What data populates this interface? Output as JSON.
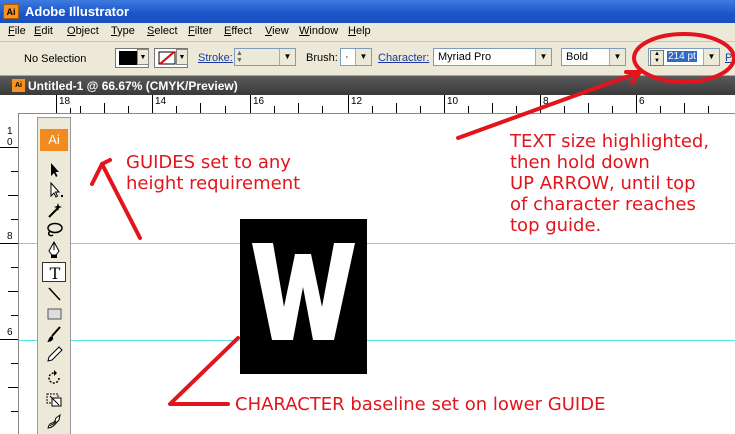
{
  "window": {
    "app_icon": "Ai",
    "title": "Adobe Illustrator"
  },
  "menu": [
    "File",
    "Edit",
    "Object",
    "Type",
    "Select",
    "Filter",
    "Effect",
    "View",
    "Window",
    "Help"
  ],
  "control_bar": {
    "selection": "No Selection",
    "stroke_label": "Stroke:",
    "brush_label": "Brush:",
    "brush_value": "·",
    "character_label": "Character:",
    "font_family": "Myriad Pro",
    "font_style": "Bold",
    "font_size": "214 pt",
    "overflow_label": "Pa",
    "fill_color": "#000000"
  },
  "document": {
    "icon": "Ai",
    "title": "Untitled-1 @ 66.67% (CMYK/Preview)"
  },
  "rulers": {
    "horizontal": [
      "18",
      "14",
      "16",
      "12",
      "10",
      "8",
      "6"
    ],
    "vertical": [
      "1",
      "0",
      "8",
      "6"
    ]
  },
  "toolbox": {
    "badge": "Ai",
    "tools": [
      "selection-tool",
      "direct-selection-tool",
      "magic-wand-tool",
      "lasso-tool",
      "pen-tool",
      "type-tool",
      "line-tool",
      "rectangle-tool",
      "paintbrush-tool",
      "pencil-tool",
      "rotate-tool",
      "scale-tool",
      "warp-tool"
    ]
  },
  "artwork": {
    "letter": "W"
  },
  "annotations": {
    "guides": [
      "GUIDES set to any",
      "height requirement"
    ],
    "text_size": [
      "TEXT size highlighted,",
      "then hold down",
      "UP ARROW, until top",
      "of character reaches",
      "top guide."
    ],
    "baseline": "CHARACTER baseline set on lower GUIDE",
    "accent_color": "#e2141c",
    "guide_color": "#59e6e6"
  }
}
